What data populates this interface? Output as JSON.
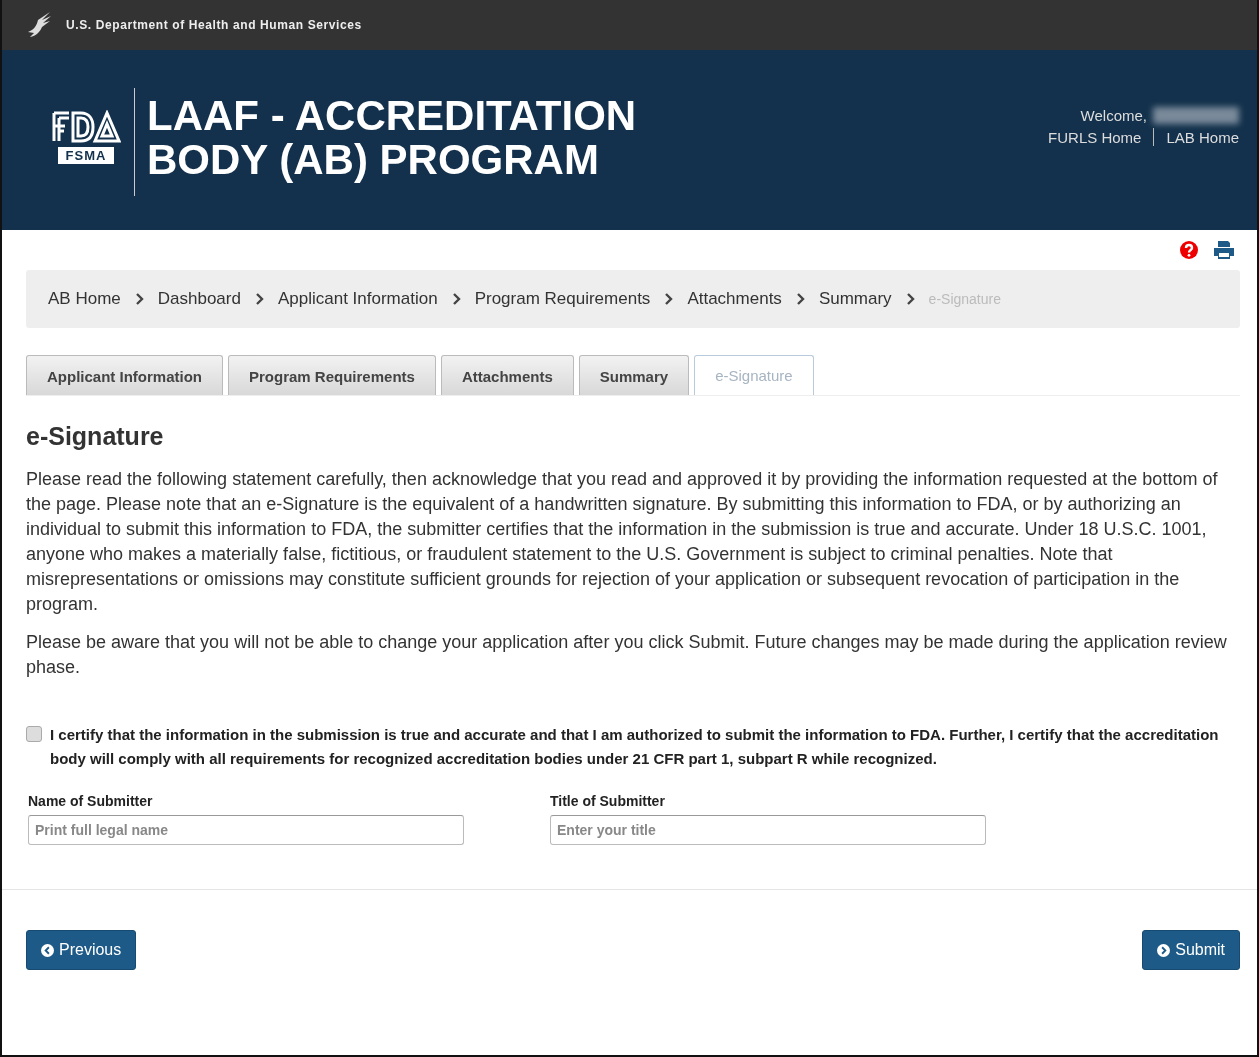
{
  "top_bar": {
    "agency": "U.S. Department of Health and Human Services"
  },
  "header": {
    "logo_text": "FSMA",
    "title_line_1": "LAAF - ACCREDITATION",
    "title_line_2": "BODY (AB) PROGRAM",
    "welcome": "Welcome,",
    "links": [
      "FURLS Home",
      "LAB Home"
    ]
  },
  "breadcrumb": [
    {
      "label": "AB Home",
      "current": false
    },
    {
      "label": "Dashboard",
      "current": false
    },
    {
      "label": "Applicant Information",
      "current": false
    },
    {
      "label": "Program Requirements",
      "current": false
    },
    {
      "label": "Attachments",
      "current": false
    },
    {
      "label": "Summary",
      "current": false
    },
    {
      "label": "e-Signature",
      "current": true
    }
  ],
  "tabs": [
    {
      "label": "Applicant Information",
      "selected": false
    },
    {
      "label": "Program Requirements",
      "selected": false
    },
    {
      "label": "Attachments",
      "selected": false
    },
    {
      "label": "Summary",
      "selected": false
    },
    {
      "label": "e-Signature",
      "selected": true
    }
  ],
  "heading": "e-Signature",
  "paragraphs": [
    "Please read the following statement carefully, then acknowledge that you read and approved it by providing the information requested at the bottom of the page. Please note that an e-Signature is the equivalent of a handwritten signature. By submitting this information to FDA, or by authorizing an individual to submit this information to FDA, the submitter certifies that the information in the submission is true and accurate. Under 18 U.S.C. 1001, anyone who makes a materially false, fictitious, or fraudulent statement to the U.S. Government is subject to criminal penalties. Note that misrepresentations or omissions may constitute sufficient grounds for rejection of your application or subsequent revocation of participation in the program.",
    "Please be aware that you will not be able to change your application after you click Submit. Future changes may be made during the application review phase."
  ],
  "certify": {
    "checked": false,
    "label": "I certify that the information in the submission is true and accurate and that I am authorized to submit the information to FDA. Further, I certify that the accreditation body will comply with all requirements for recognized accreditation bodies under 21 CFR part 1, subpart R while recognized."
  },
  "fields": [
    {
      "label": "Name of Submitter",
      "placeholder": "Print full legal name"
    },
    {
      "label": "Title of Submitter",
      "placeholder": "Enter your title"
    }
  ],
  "buttons": {
    "previous": "Previous",
    "submit": "Submit"
  }
}
